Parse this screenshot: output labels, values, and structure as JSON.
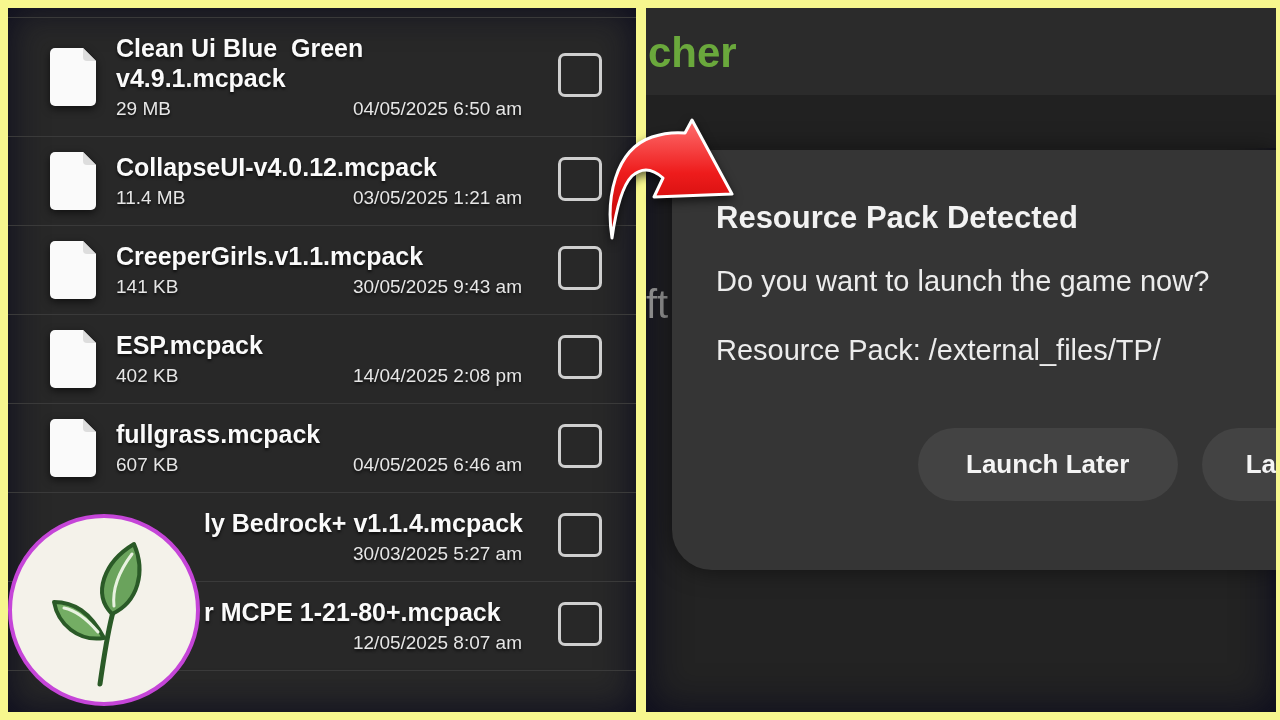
{
  "file_list": {
    "items": [
      {
        "kind": "file",
        "name": "Clean Ui Blue  Green v4.9.1.mcpack",
        "size": "29 MB",
        "date": "04/05/2025 6:50 am",
        "checked": false
      },
      {
        "kind": "file",
        "name": "CollapseUI-v4.0.12.mcpack",
        "size": "11.4 MB",
        "date": "03/05/2025 1:21 am",
        "checked": false
      },
      {
        "kind": "file",
        "name": "CreeperGirls.v1.1.mcpack",
        "size": "141 KB",
        "date": "30/05/2025 9:43 am",
        "checked": false
      },
      {
        "kind": "file",
        "name": "ESP.mcpack",
        "size": "402 KB",
        "date": "14/04/2025 2:08 pm",
        "checked": false
      },
      {
        "kind": "file",
        "name": "fullgrass.mcpack",
        "size": "607 KB",
        "date": "04/05/2025 6:46 am",
        "checked": false
      },
      {
        "kind": "covered",
        "name": "ly Bedrock+ v1.1.4.mcpack",
        "date": "30/03/2025 5:27 am",
        "checked": false
      },
      {
        "kind": "covered",
        "name": "r MCPE 1-21-80+.mcpack",
        "date": "12/05/2025 8:07 am",
        "checked": false
      }
    ]
  },
  "launcher": {
    "app_title": "cher",
    "background_text": "ft",
    "dialog": {
      "title": "Resource Pack Detected",
      "message": "Do you want to launch the game now?",
      "detail": "Resource Pack: /external_files/TP/",
      "buttons": [
        "Launch Later",
        "La"
      ]
    }
  }
}
